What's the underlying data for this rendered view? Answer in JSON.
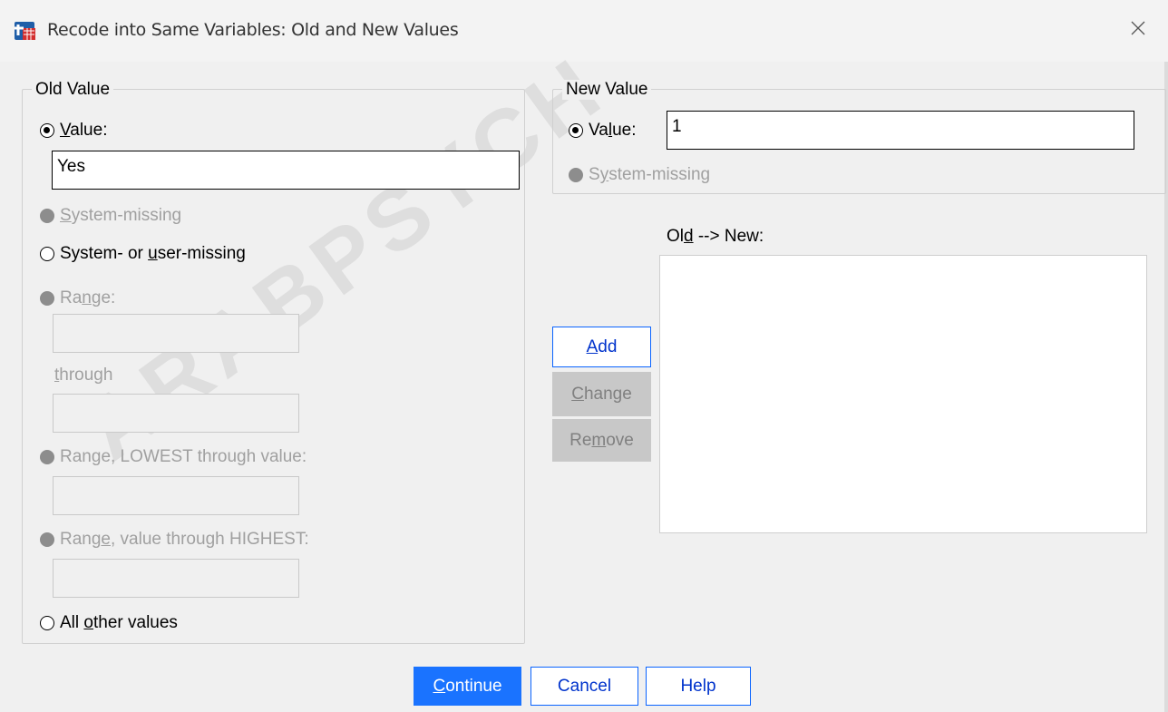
{
  "window": {
    "title": "Recode into Same Variables: Old and New Values"
  },
  "old_value": {
    "label": "Old Value",
    "value_radio": {
      "label_pre": "",
      "mnemonic": "V",
      "label_post": "alue:",
      "checked": true
    },
    "value_input": "Yes",
    "system_missing": {
      "mnemonic": "S",
      "label_post": "ystem-missing"
    },
    "sys_or_user_missing": {
      "label_pre": "System- or ",
      "mnemonic": "u",
      "label_post": "ser-missing"
    },
    "range": {
      "label_pre": "Ra",
      "mnemonic": "n",
      "label_post": "ge:"
    },
    "through": {
      "mnemonic": "t",
      "label_post": "hrough"
    },
    "range_lowest": {
      "label_pre": "Ran",
      "mnemonic": "g",
      "label_post": "e, LOWEST through value:"
    },
    "range_highest": {
      "label_pre": "Rang",
      "mnemonic": "e",
      "label_post": ", value through HIGHEST:"
    },
    "all_other": {
      "label_pre": "All ",
      "mnemonic": "o",
      "label_post": "ther values"
    }
  },
  "new_value": {
    "label": "New Value",
    "value_radio": {
      "label_pre": "Va",
      "mnemonic": "l",
      "label_post": "ue:",
      "checked": true
    },
    "value_input": "1",
    "system_missing": {
      "label_pre": "S",
      "mnemonic": "y",
      "label_post": "stem-missing"
    }
  },
  "mapping": {
    "label_pre": "Ol",
    "mnemonic": "d",
    "label_post": " --> New:",
    "items": []
  },
  "buttons": {
    "add": {
      "mnemonic": "A",
      "label_post": "dd"
    },
    "change": {
      "mnemonic": "C",
      "label_post": "hange"
    },
    "remove": {
      "label_pre": "Re",
      "mnemonic": "m",
      "label_post": "ove"
    },
    "continue": {
      "mnemonic": "C",
      "label_post": "ontinue"
    },
    "cancel": "Cancel",
    "help": "Help"
  },
  "watermark": "ARABPSYCH",
  "colors": {
    "accent": "#1a73ff",
    "disabled_text": "#a0a0a0",
    "dialog_bg": "#f0f0f0"
  }
}
